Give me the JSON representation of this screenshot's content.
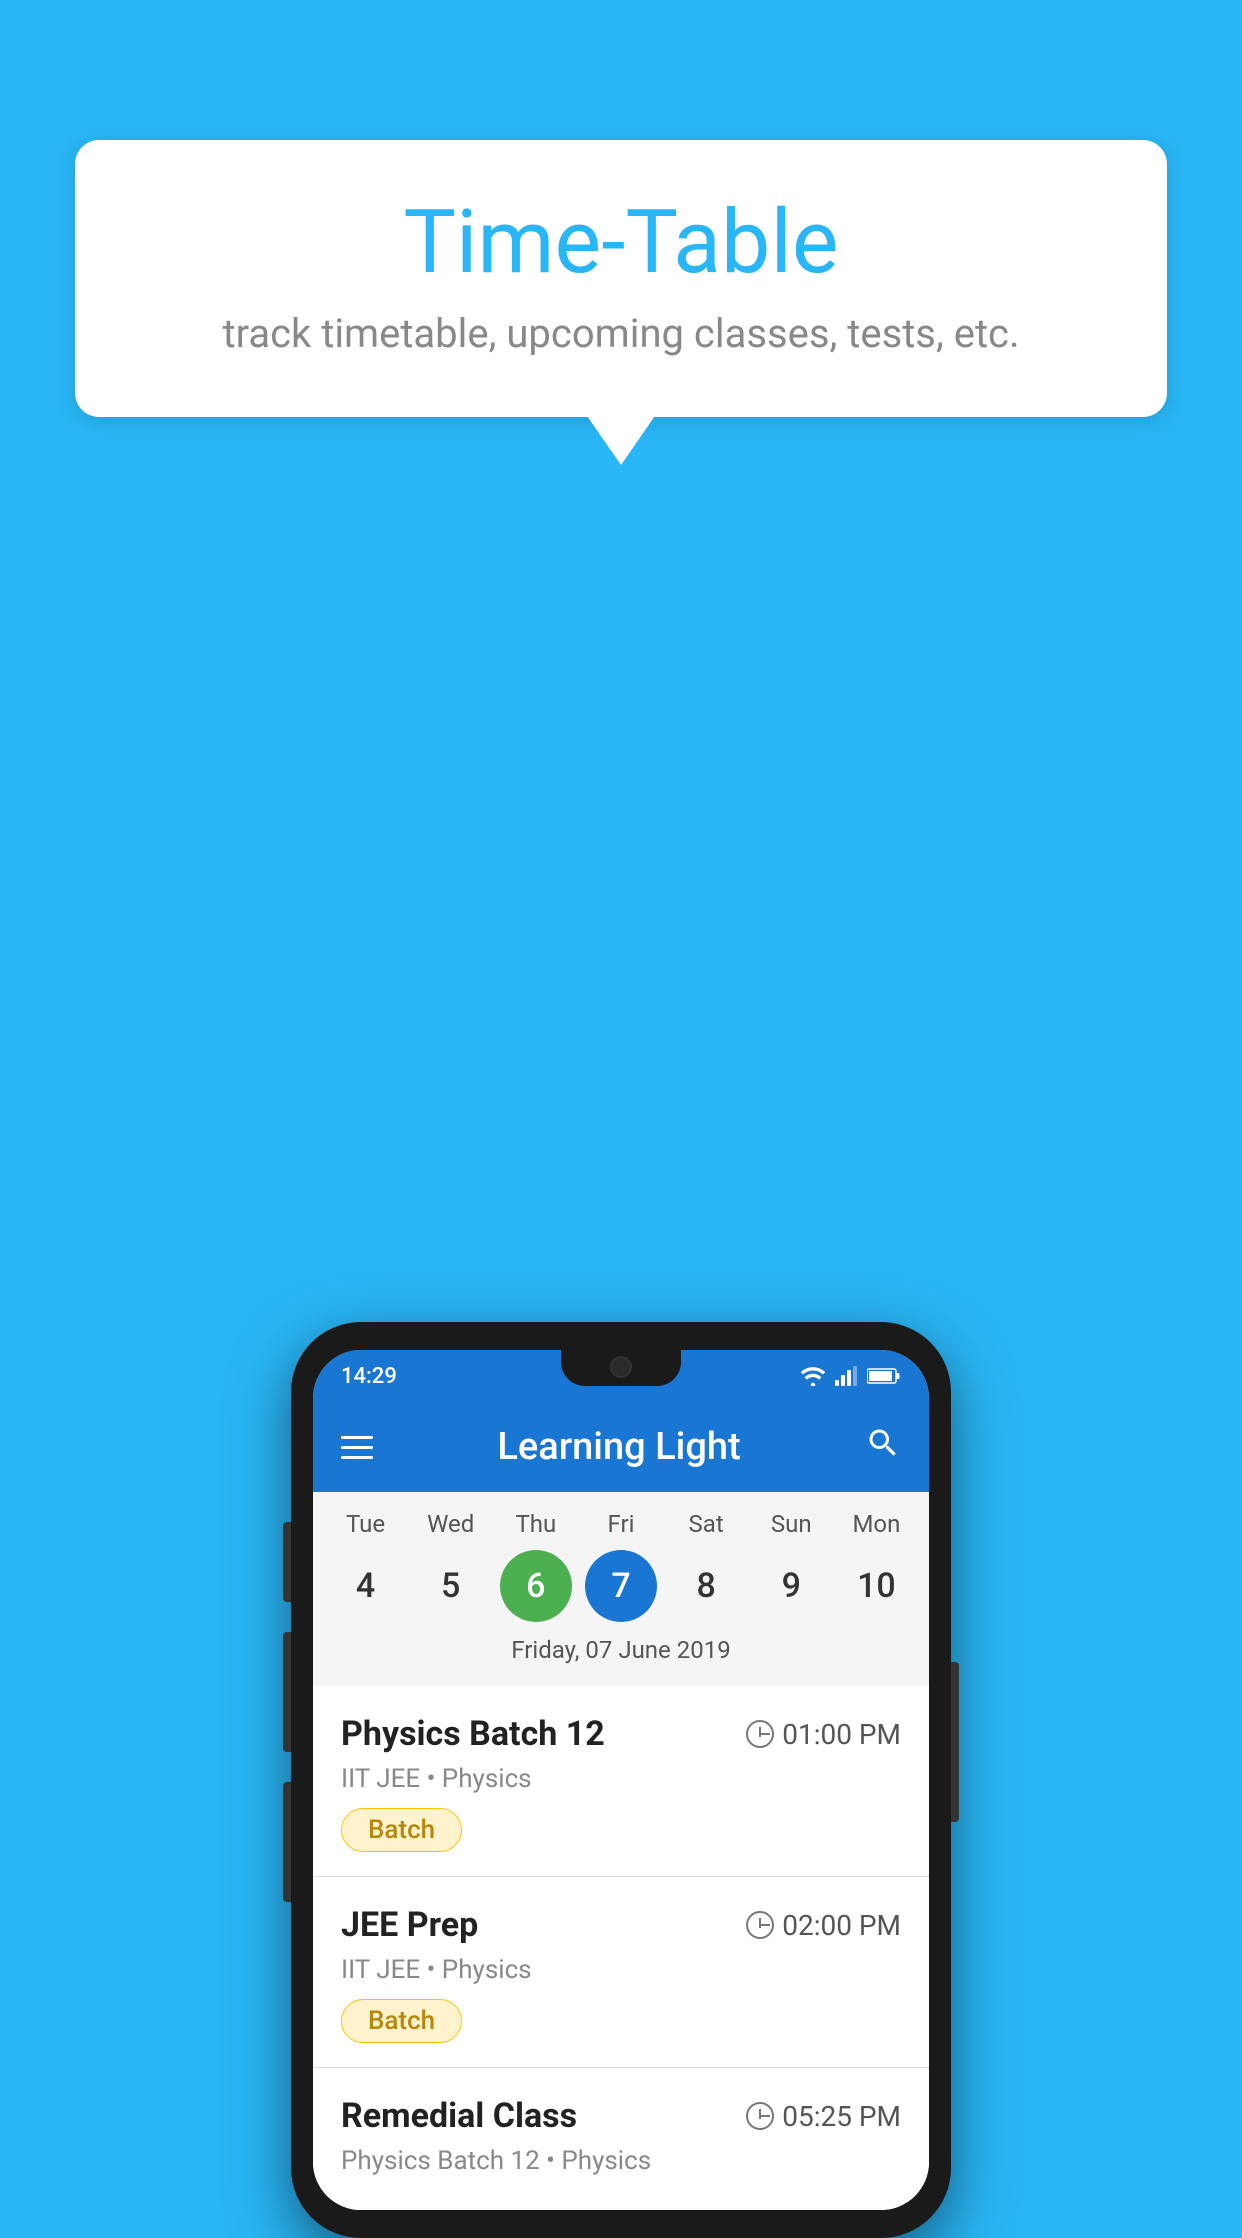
{
  "background_color": "#29b6f6",
  "speech_bubble": {
    "title": "Time-Table",
    "subtitle": "track timetable, upcoming classes, tests, etc."
  },
  "phone": {
    "status_bar": {
      "time": "14:29"
    },
    "app_bar": {
      "title": "Learning Light"
    },
    "calendar": {
      "day_headers": [
        "Tue",
        "Wed",
        "Thu",
        "Fri",
        "Sat",
        "Sun",
        "Mon"
      ],
      "day_numbers": [
        {
          "number": "4",
          "state": "normal"
        },
        {
          "number": "5",
          "state": "normal"
        },
        {
          "number": "6",
          "state": "today"
        },
        {
          "number": "7",
          "state": "selected"
        },
        {
          "number": "8",
          "state": "normal"
        },
        {
          "number": "9",
          "state": "normal"
        },
        {
          "number": "10",
          "state": "normal"
        }
      ],
      "selected_date_label": "Friday, 07 June 2019"
    },
    "classes": [
      {
        "name": "Physics Batch 12",
        "time": "01:00 PM",
        "subtitle": "IIT JEE • Physics",
        "tag": "Batch"
      },
      {
        "name": "JEE Prep",
        "time": "02:00 PM",
        "subtitle": "IIT JEE • Physics",
        "tag": "Batch"
      },
      {
        "name": "Remedial Class",
        "time": "05:25 PM",
        "subtitle": "Physics Batch 12 • Physics",
        "tag": null
      }
    ]
  }
}
